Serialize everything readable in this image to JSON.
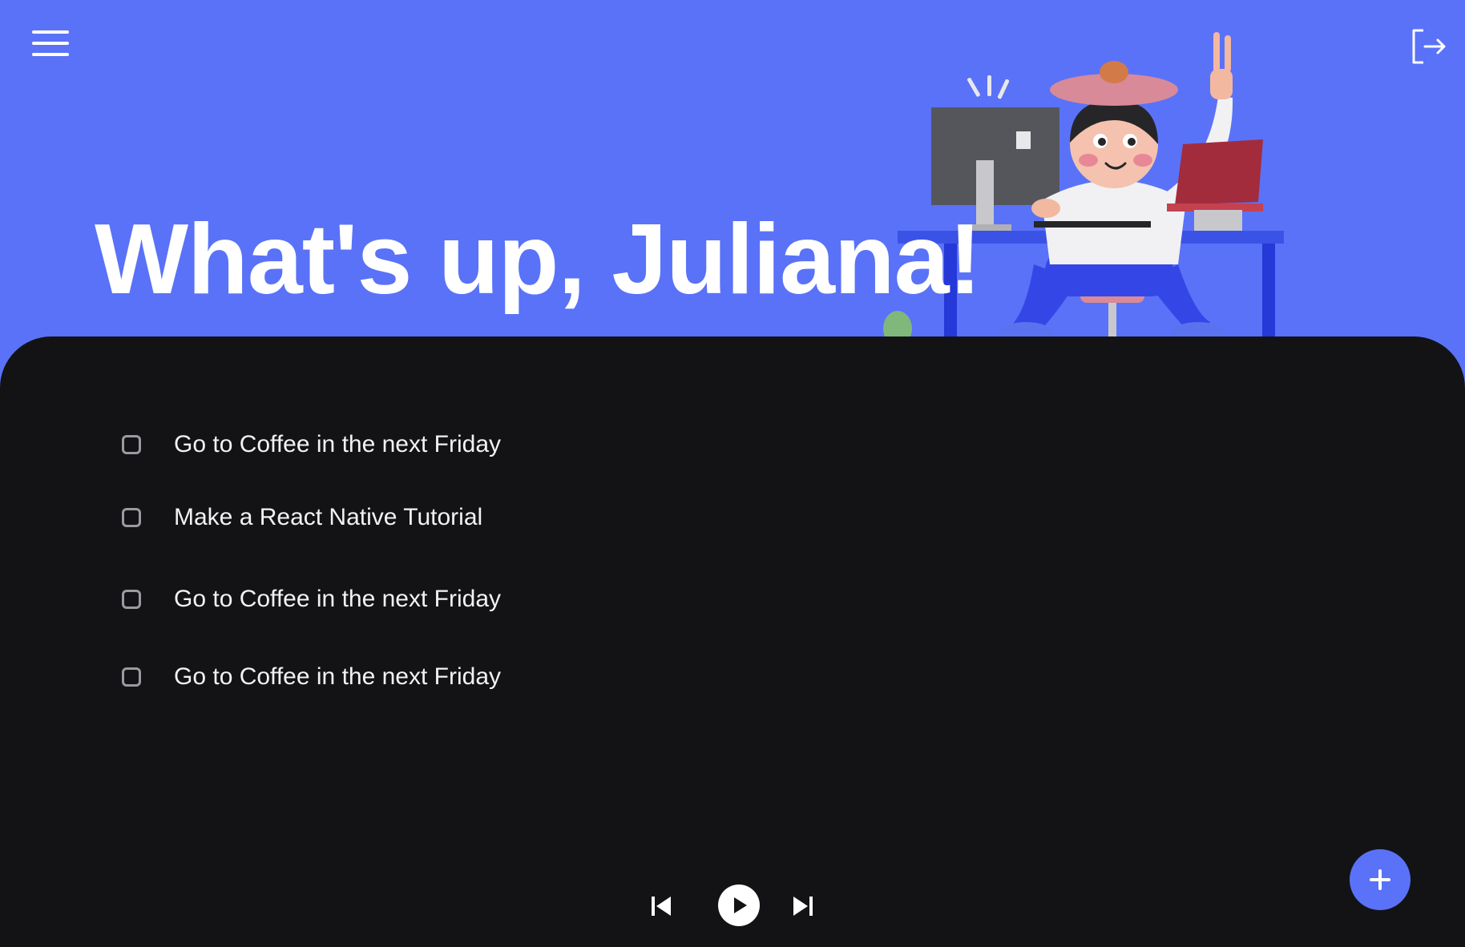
{
  "header": {
    "greeting": "What's up, Juliana!",
    "menu_icon": "hamburger-menu-icon",
    "logout_icon": "logout-icon",
    "illustration": "person-at-desk-illustration"
  },
  "tasks": [
    {
      "label": "Go to Coffee in the next Friday",
      "checked": false
    },
    {
      "label": "Make a React Native Tutorial",
      "checked": false
    },
    {
      "label": "Go to Coffee in the next Friday",
      "checked": false
    },
    {
      "label": "Go to Coffee in the next Friday",
      "checked": false
    }
  ],
  "player": {
    "prev_icon": "skip-previous-icon",
    "play_icon": "play-icon",
    "next_icon": "skip-next-icon"
  },
  "fab": {
    "icon": "plus-icon"
  },
  "colors": {
    "accent": "#5A72F8",
    "panel": "#131316",
    "text": "#F2F2F2"
  }
}
